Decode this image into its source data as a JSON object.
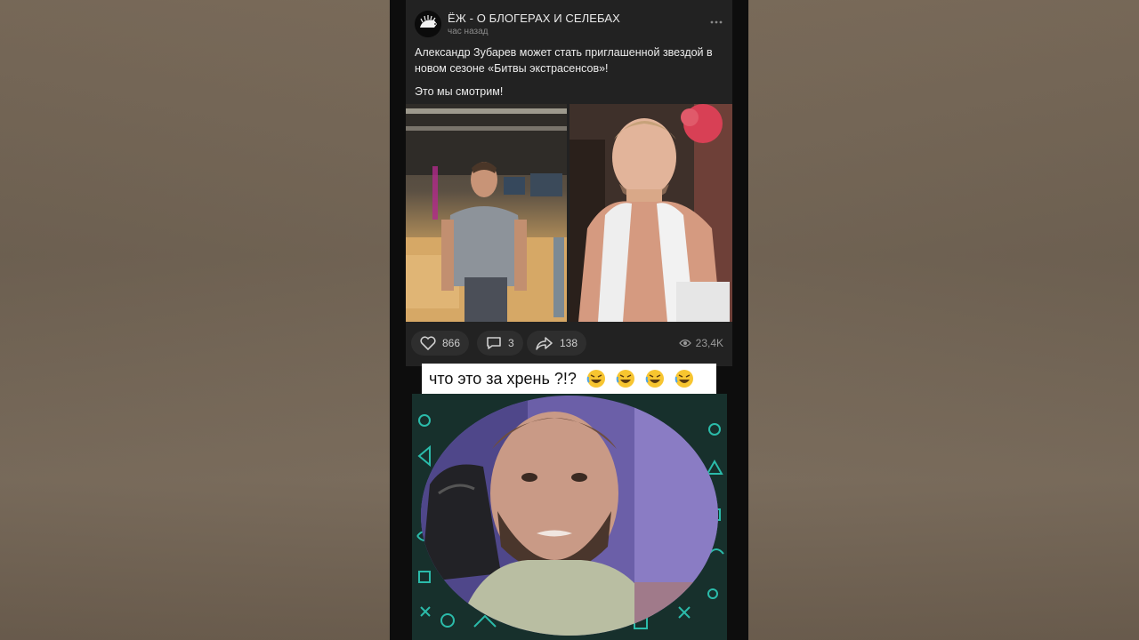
{
  "channel": {
    "name": "ЁЖ - О БЛОГЕРАХ И СЕЛЕБАХ",
    "time": "час назад"
  },
  "post": {
    "text_line1": "Александр Зубарев может стать приглашенной звездой в новом сезоне «Битвы экстрасенсов»!",
    "text_line2": "Это мы смотрим!"
  },
  "actions": {
    "likes": "866",
    "comments": "3",
    "shares": "138",
    "views": "23,4K"
  },
  "caption": {
    "text": "что это за хрень ?!?"
  },
  "colors": {
    "card_bg": "#222222",
    "pill_bg": "#2e2e2e",
    "caption_bg": "#ffffff",
    "emoji_yellow": "#f7c530"
  },
  "icons": [
    "hedgehog-logo-icon",
    "more-icon",
    "heart-icon",
    "comment-icon",
    "share-icon",
    "eye-icon",
    "laughing-emoji-icon"
  ]
}
